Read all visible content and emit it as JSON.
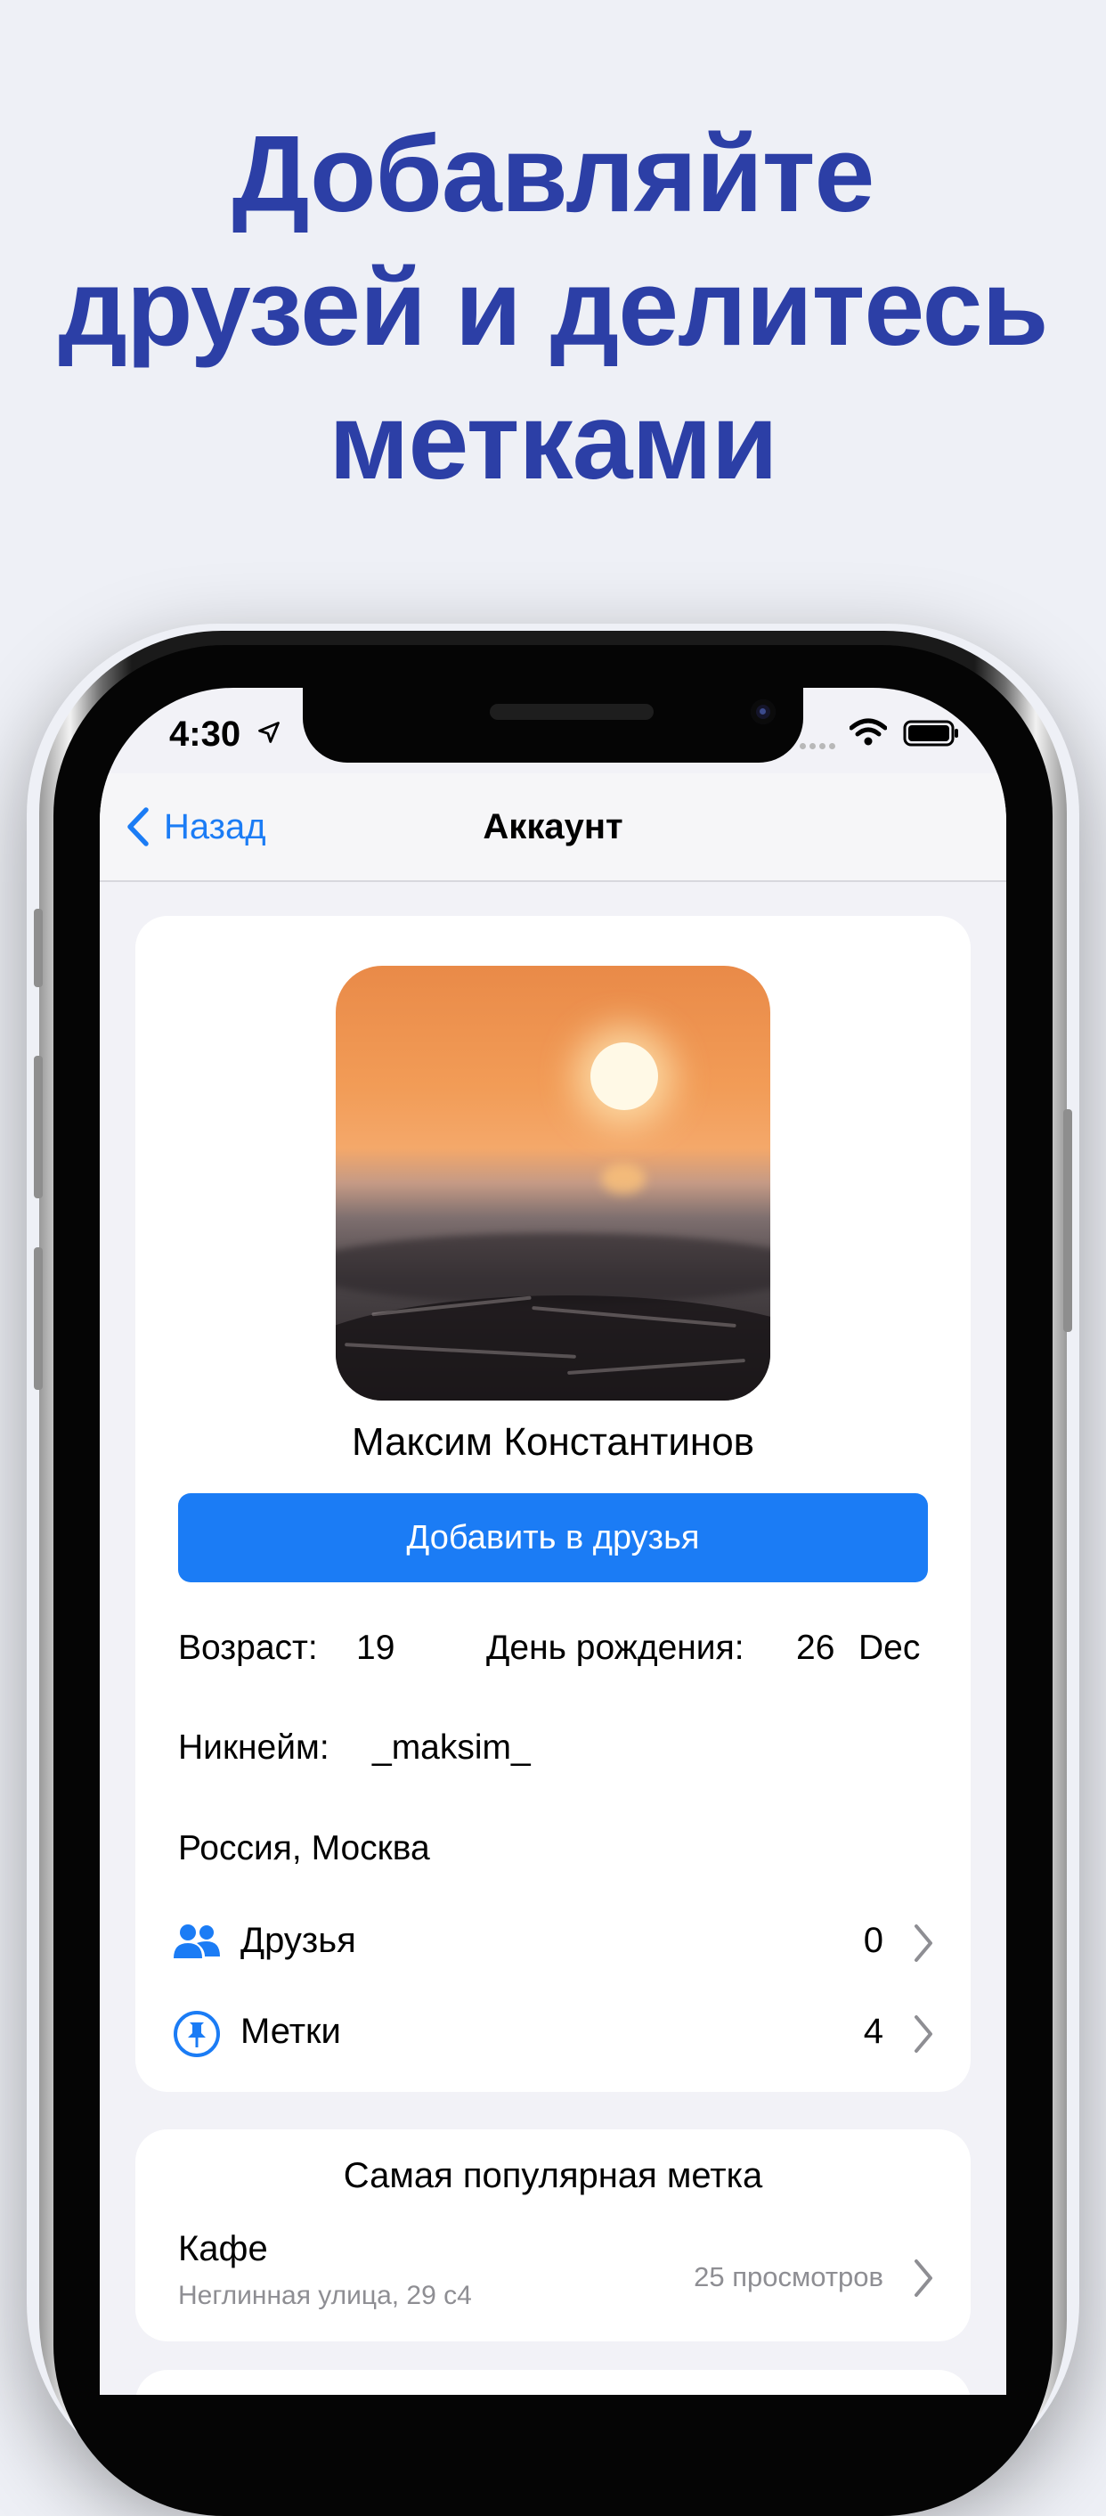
{
  "headline": {
    "line1": "Добавляйте",
    "line2": "друзей и делитесь",
    "line3": "метками"
  },
  "status_bar": {
    "time": "4:30"
  },
  "nav": {
    "back_label": "Назад",
    "title": "Аккаунт"
  },
  "profile": {
    "name": "Максим Константинов",
    "add_friend_label": "Добавить в друзья",
    "age_label": "Возраст:",
    "age_value": "19",
    "birthday_label": "День рождения:",
    "birthday_day": "26",
    "birthday_month": "Dec",
    "nickname_label": "Никнейм:",
    "nickname_value": "_maksim_",
    "location": "Россия, Москва"
  },
  "lists": {
    "friends": {
      "label": "Друзья",
      "count": "0"
    },
    "tags": {
      "label": "Метки",
      "count": "4"
    }
  },
  "popular": {
    "title": "Самая популярная метка",
    "place_name": "Кафе",
    "place_address": "Неглинная улица, 29 с4",
    "views": "25 просмотров"
  },
  "colors": {
    "accent": "#1b7cf5",
    "headline": "#2c3fa6",
    "background": "#eef0f6",
    "secondary_text": "#8e8e93"
  }
}
